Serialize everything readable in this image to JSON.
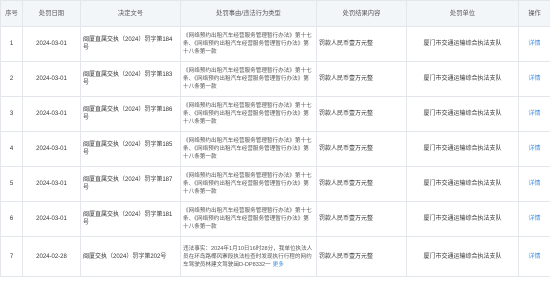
{
  "table": {
    "headers": [
      "序号",
      "处罚日期",
      "决定文号",
      "处罚事由/违法行为类型",
      "处罚结果内容",
      "处罚单位",
      "操作"
    ],
    "rows": [
      {
        "idx": "1",
        "date": "2024-03-01",
        "doc": "闽厦直属交执（2024）罚字第184号",
        "reason": "《网络预约出租汽车经营服务管理暂行办法》第十七条、《网络预约出租汽车经营服务管理暂行办法》第十八条第一款",
        "result": "罚款人民币壹万元整",
        "unit": "厦门市交通运输综合执法支队",
        "action": "详情"
      },
      {
        "idx": "2",
        "date": "2024-03-01",
        "doc": "闽厦直属交执（2024）罚字第183号",
        "reason": "《网络预约出租汽车经营服务管理暂行办法》第十七条、《网络预约出租汽车经营服务管理暂行办法》第十八条第一款",
        "result": "罚款人民币壹万元整",
        "unit": "厦门市交通运输综合执法支队",
        "action": "详情"
      },
      {
        "idx": "3",
        "date": "2024-03-01",
        "doc": "闽厦直属交执（2024）罚字第186号",
        "reason": "《网络预约出租汽车经营服务管理暂行办法》第十七条、《网络预约出租汽车经营服务管理暂行办法》第十八条第一款",
        "result": "罚款人民币壹万元整",
        "unit": "厦门市交通运输综合执法支队",
        "action": "详情"
      },
      {
        "idx": "4",
        "date": "2024-03-01",
        "doc": "闽厦直属交执（2024）罚字第185号",
        "reason": "《网络预约出租汽车经营服务管理暂行办法》第十七条、《网络预约出租汽车经营服务管理暂行办法》第十八条第一款",
        "result": "罚款人民币壹万元整",
        "unit": "厦门市交通运输综合执法支队",
        "action": "详情"
      },
      {
        "idx": "5",
        "date": "2024-03-01",
        "doc": "闽厦直属交执（2024）罚字第187号",
        "reason": "《网络预约出租汽车经营服务管理暂行办法》第十七条、《网络预约出租汽车经营服务管理暂行办法》第十八条第一款",
        "result": "罚款人民币壹万元整",
        "unit": "厦门市交通运输综合执法支队",
        "action": "详情"
      },
      {
        "idx": "6",
        "date": "2024-03-01",
        "doc": "闽厦直属交执（2024）罚字第181号",
        "reason": "《网络预约出租汽车经营服务管理暂行办法》第十七条、《网络预约出租汽车经营服务管理暂行办法》第十八条第一款",
        "result": "罚款人民币壹万元整",
        "unit": "厦门市交通运输综合执法支队",
        "action": "详情"
      },
      {
        "idx": "7",
        "date": "2024-02-28",
        "doc": "闽厦交执（2024）罚字第202号",
        "reason": "违法事实：2024年1月10日16时28分，我单位执法人员在环岛路椰风寨段执法检查时发现执行行程的网约车驾驶员林建文驾驶闽D-DP8332一",
        "more": "更多",
        "result": "罚款人民币壹万元整",
        "unit": "厦门市交通运输综合执法支队",
        "action": "详情"
      }
    ]
  }
}
